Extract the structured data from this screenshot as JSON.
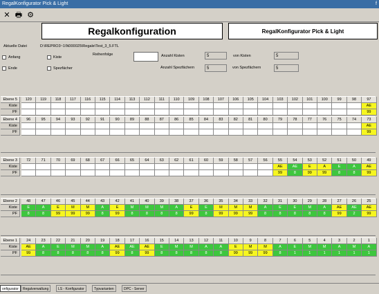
{
  "window": {
    "title": "RegalKonfigurator Pick & Light"
  },
  "toolbar": {
    "close_glyph": "✕",
    "print_glyph": "🖶",
    "config_glyph": "⚙"
  },
  "header": {
    "title": "Regalkonfiguration",
    "subtitle": "RegalKonfigurator Pick & Light"
  },
  "form": {
    "file_label": "Aktuelle Datei",
    "file_path": "D:\\REPRO3~1\\N000025\\Regale\\Test_3_5.FTL",
    "cb_anfang": "Anfang",
    "cb_ende": "Ende",
    "cb_kiste": "Kiste",
    "cb_spezfaecher": "Spezfächer",
    "reihenfolge_label": "Reihenfolge",
    "anzahl_kisten_label": "Anzahl Kisten",
    "anzahl_kisten_value": "5",
    "anzahl_spez_label": "Anzahl Spezfächern",
    "anzahl_spez_value": "5",
    "von_kisten_label": "von Kisten",
    "von_kisten_value": "5",
    "von_spez_label": "von Spezfächern",
    "von_spez_value": "5"
  },
  "row_labels": {
    "kiste": "Kiste",
    "pf": "PF"
  },
  "levels": [
    {
      "name": "Ebene 5",
      "numbers": [
        "120",
        "119",
        "118",
        "117",
        "116",
        "115",
        "114",
        "113",
        "112",
        "111",
        "110",
        "109",
        "108",
        "107",
        "106",
        "105",
        "104",
        "103",
        "102",
        "101",
        "100",
        "99",
        "98",
        "97"
      ],
      "kiste": [
        "",
        "",
        "",
        "",
        "",
        "",
        "",
        "",
        "",
        "",
        "",
        "",
        "",
        "",
        "",
        "",
        "",
        "",
        "",
        "",
        "",
        "",
        "",
        "AE"
      ],
      "pf": [
        "",
        "",
        "",
        "",
        "",
        "",
        "",
        "",
        "",
        "",
        "",
        "",
        "",
        "",
        "",
        "",
        "",
        "",
        "",
        "",
        "",
        "",
        "",
        "99"
      ],
      "colors": [
        "",
        "",
        "",
        "",
        "",
        "",
        "",
        "",
        "",
        "",
        "",
        "",
        "",
        "",
        "",
        "",
        "",
        "",
        "",
        "",
        "",
        "",
        "",
        "y"
      ]
    },
    {
      "name": "Ebene 4",
      "numbers": [
        "96",
        "95",
        "94",
        "93",
        "92",
        "91",
        "90",
        "89",
        "88",
        "87",
        "86",
        "85",
        "84",
        "83",
        "82",
        "81",
        "80",
        "79",
        "78",
        "77",
        "76",
        "75",
        "74",
        "73"
      ],
      "kiste": [
        "",
        "",
        "",
        "",
        "",
        "",
        "",
        "",
        "",
        "",
        "",
        "",
        "",
        "",
        "",
        "",
        "",
        "",
        "",
        "",
        "",
        "",
        "",
        "AE"
      ],
      "pf": [
        "",
        "",
        "",
        "",
        "",
        "",
        "",
        "",
        "",
        "",
        "",
        "",
        "",
        "",
        "",
        "",
        "",
        "",
        "",
        "",
        "",
        "",
        "",
        "99"
      ],
      "colors": [
        "",
        "",
        "",
        "",
        "",
        "",
        "",
        "",
        "",
        "",
        "",
        "",
        "",
        "",
        "",
        "",
        "",
        "",
        "",
        "",
        "",
        "",
        "",
        "y"
      ]
    },
    {
      "name": "Ebene 3",
      "numbers": [
        "72",
        "71",
        "70",
        "69",
        "68",
        "67",
        "66",
        "65",
        "64",
        "63",
        "62",
        "61",
        "60",
        "59",
        "58",
        "57",
        "56",
        "55",
        "54",
        "53",
        "52",
        "51",
        "50",
        "49"
      ],
      "kiste": [
        "",
        "",
        "",
        "",
        "",
        "",
        "",
        "",
        "",
        "",
        "",
        "",
        "",
        "",
        "",
        "",
        "",
        "AE",
        "AE",
        "E",
        "A",
        "E",
        "A",
        "AE"
      ],
      "pf": [
        "",
        "",
        "",
        "",
        "",
        "",
        "",
        "",
        "",
        "",
        "",
        "",
        "",
        "",
        "",
        "",
        "",
        "99",
        "8",
        "99",
        "99",
        "8",
        "8",
        "99"
      ],
      "colors": [
        "",
        "",
        "",
        "",
        "",
        "",
        "",
        "",
        "",
        "",
        "",
        "",
        "",
        "",
        "",
        "",
        "",
        "y",
        "g",
        "y",
        "y",
        "g",
        "g",
        "y"
      ]
    },
    {
      "name": "Ebene 2",
      "numbers": [
        "48",
        "47",
        "46",
        "45",
        "44",
        "43",
        "42",
        "41",
        "40",
        "39",
        "38",
        "37",
        "36",
        "35",
        "34",
        "33",
        "32",
        "31",
        "30",
        "29",
        "28",
        "27",
        "26",
        "25"
      ],
      "kiste": [
        "E",
        "A",
        "E",
        "M",
        "M",
        "A",
        "E",
        "M",
        "M",
        "M",
        "A",
        "E",
        "E",
        "M",
        "M",
        "M",
        "A",
        "E",
        "E",
        "M",
        "A",
        "AE",
        "AE",
        "AE"
      ],
      "pf": [
        "8",
        "8",
        "99",
        "99",
        "99",
        "8",
        "99",
        "8",
        "8",
        "8",
        "8",
        "99",
        "8",
        "99",
        "99",
        "99",
        "8",
        "8",
        "8",
        "8",
        "8",
        "99",
        "2",
        "99"
      ],
      "colors": [
        "g",
        "g",
        "y",
        "y",
        "y",
        "g",
        "y",
        "g",
        "g",
        "g",
        "g",
        "y",
        "g",
        "y",
        "y",
        "y",
        "g",
        "g",
        "g",
        "g",
        "g",
        "y",
        "g",
        "y"
      ]
    },
    {
      "name": "Ebene 1",
      "numbers": [
        "24",
        "23",
        "22",
        "21",
        "20",
        "19",
        "18",
        "17",
        "16",
        "15",
        "14",
        "13",
        "12",
        "11",
        "10",
        "9",
        "8",
        "7",
        "6",
        "5",
        "4",
        "3",
        "2",
        "1"
      ],
      "kiste": [
        "AE",
        "A",
        "E",
        "M",
        "M",
        "A",
        "AE",
        "AE",
        "AE",
        "E",
        "M",
        "M",
        "A",
        "A",
        "E",
        "M",
        "M",
        "A",
        "E",
        "M",
        "M",
        "A",
        "M",
        "A"
      ],
      "pf": [
        "99",
        "8",
        "8",
        "8",
        "8",
        "8",
        "99",
        "8",
        "99",
        "8",
        "8",
        "8",
        "8",
        "8",
        "99",
        "99",
        "99",
        "8",
        "1",
        "1",
        "1",
        "1",
        "1",
        "1"
      ],
      "colors": [
        "y",
        "g",
        "g",
        "g",
        "g",
        "g",
        "y",
        "g",
        "y",
        "g",
        "g",
        "g",
        "g",
        "g",
        "y",
        "y",
        "y",
        "g",
        "g",
        "g",
        "g",
        "g",
        "g",
        "g"
      ]
    }
  ],
  "tabs": [
    "onfigurator",
    "Regalverwaltung",
    "LS - Konfigurator",
    "Typvarianten",
    "DPC - Server"
  ]
}
